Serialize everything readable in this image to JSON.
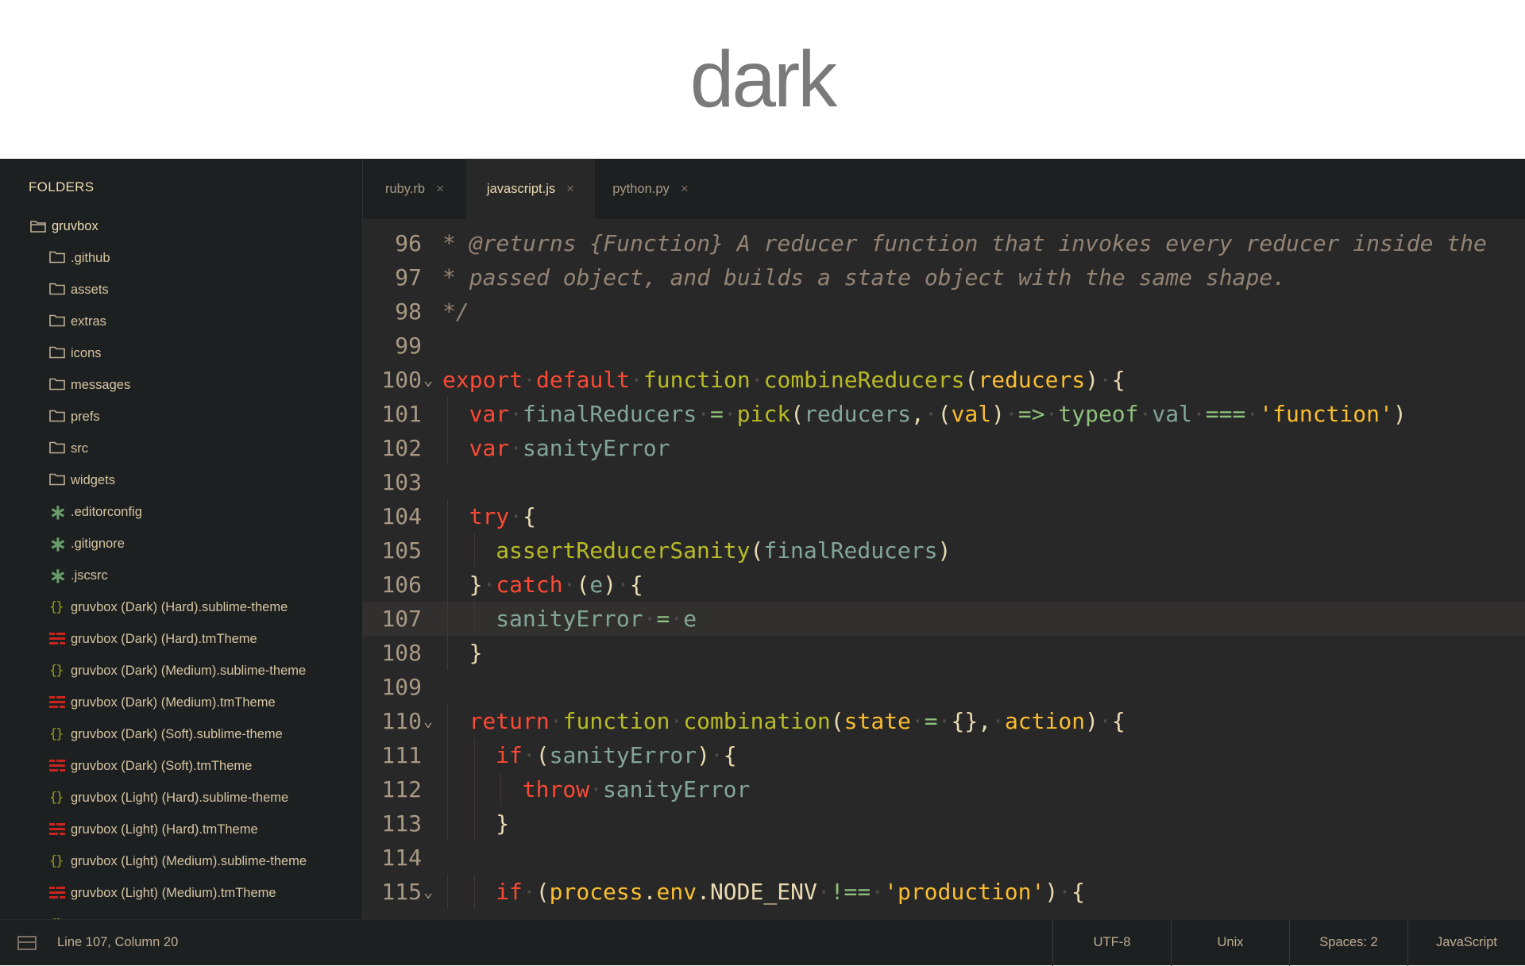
{
  "page": {
    "title": "dark"
  },
  "sidebar": {
    "header": "FOLDERS",
    "root": "gruvbox",
    "items": [
      {
        "label": ".github",
        "icon": "folder-icon"
      },
      {
        "label": "assets",
        "icon": "folder-icon"
      },
      {
        "label": "extras",
        "icon": "folder-icon"
      },
      {
        "label": "icons",
        "icon": "folder-icon"
      },
      {
        "label": "messages",
        "icon": "folder-icon"
      },
      {
        "label": "prefs",
        "icon": "folder-icon"
      },
      {
        "label": "src",
        "icon": "folder-icon"
      },
      {
        "label": "widgets",
        "icon": "folder-icon"
      },
      {
        "label": ".editorconfig",
        "icon": "asterisk-icon"
      },
      {
        "label": ".gitignore",
        "icon": "asterisk-icon"
      },
      {
        "label": ".jscsrc",
        "icon": "asterisk-icon"
      },
      {
        "label": "gruvbox (Dark) (Hard).sublime-theme",
        "icon": "braces-icon"
      },
      {
        "label": "gruvbox (Dark) (Hard).tmTheme",
        "icon": "lines-icon"
      },
      {
        "label": "gruvbox (Dark) (Medium).sublime-theme",
        "icon": "braces-icon"
      },
      {
        "label": "gruvbox (Dark) (Medium).tmTheme",
        "icon": "lines-icon"
      },
      {
        "label": "gruvbox (Dark) (Soft).sublime-theme",
        "icon": "braces-icon"
      },
      {
        "label": "gruvbox (Dark) (Soft).tmTheme",
        "icon": "lines-icon"
      },
      {
        "label": "gruvbox (Light) (Hard).sublime-theme",
        "icon": "braces-icon"
      },
      {
        "label": "gruvbox (Light) (Hard).tmTheme",
        "icon": "lines-icon"
      },
      {
        "label": "gruvbox (Light) (Medium).sublime-theme",
        "icon": "braces-icon"
      },
      {
        "label": "gruvbox (Light) (Medium).tmTheme",
        "icon": "lines-icon"
      },
      {
        "label": "gruvbox (Light) (Soft).sublime-theme",
        "icon": "braces-icon"
      }
    ]
  },
  "tabs": [
    {
      "label": "ruby.rb",
      "active": false
    },
    {
      "label": "javascript.js",
      "active": true
    },
    {
      "label": "python.py",
      "active": false
    }
  ],
  "tab_close_glyph": "×",
  "editor": {
    "current_line": 107,
    "lines": [
      {
        "n": "96",
        "fold": "",
        "indent": 0,
        "tokens": [
          [
            "c",
            "* @returns {Function} A reducer function that invokes every reducer inside the"
          ]
        ]
      },
      {
        "n": "97",
        "fold": "",
        "indent": 0,
        "tokens": [
          [
            "c",
            "* passed object, and builds a state object with the same shape."
          ]
        ]
      },
      {
        "n": "98",
        "fold": "",
        "indent": 0,
        "tokens": [
          [
            "c",
            "*/"
          ]
        ]
      },
      {
        "n": "99",
        "fold": "",
        "indent": 0,
        "tokens": []
      },
      {
        "n": "100",
        "fold": "⌄",
        "indent": 0,
        "tokens": [
          [
            "k",
            "export"
          ],
          [
            "d",
            "·"
          ],
          [
            "k",
            "default"
          ],
          [
            "d",
            "·"
          ],
          [
            "f",
            "function"
          ],
          [
            "d",
            "·"
          ],
          [
            "s",
            "combineReducers"
          ],
          [
            "p",
            "("
          ],
          [
            "y",
            "reducers"
          ],
          [
            "p",
            ")"
          ],
          [
            "d",
            "·"
          ],
          [
            "p",
            "{"
          ]
        ]
      },
      {
        "n": "101",
        "fold": "",
        "indent": 1,
        "tokens": [
          [
            "k",
            "var"
          ],
          [
            "d",
            "·"
          ],
          [
            "v",
            "finalReducers"
          ],
          [
            "d",
            "·"
          ],
          [
            "o",
            "="
          ],
          [
            "d",
            "·"
          ],
          [
            "s",
            "pick"
          ],
          [
            "p",
            "("
          ],
          [
            "v",
            "reducers"
          ],
          [
            "p",
            ","
          ],
          [
            "d",
            "·"
          ],
          [
            "p",
            "("
          ],
          [
            "y",
            "val"
          ],
          [
            "p",
            ")"
          ],
          [
            "d",
            "·"
          ],
          [
            "o",
            "=>"
          ],
          [
            "d",
            "·"
          ],
          [
            "v2",
            "typeof"
          ],
          [
            "d",
            "·"
          ],
          [
            "v",
            "val"
          ],
          [
            "d",
            "·"
          ],
          [
            "o",
            "==="
          ],
          [
            "d",
            "·"
          ],
          [
            "str",
            "'function'"
          ],
          [
            "p",
            ")"
          ]
        ]
      },
      {
        "n": "102",
        "fold": "",
        "indent": 1,
        "tokens": [
          [
            "k",
            "var"
          ],
          [
            "d",
            "·"
          ],
          [
            "v",
            "sanityError"
          ]
        ]
      },
      {
        "n": "103",
        "fold": "",
        "indent": 0,
        "tokens": []
      },
      {
        "n": "104",
        "fold": "",
        "indent": 1,
        "tokens": [
          [
            "k",
            "try"
          ],
          [
            "d",
            "·"
          ],
          [
            "p",
            "{"
          ]
        ]
      },
      {
        "n": "105",
        "fold": "",
        "indent": 2,
        "tokens": [
          [
            "s",
            "assertReducerSanity"
          ],
          [
            "p",
            "("
          ],
          [
            "v",
            "finalReducers"
          ],
          [
            "p",
            ")"
          ]
        ]
      },
      {
        "n": "106",
        "fold": "",
        "indent": 1,
        "tokens": [
          [
            "p",
            "}"
          ],
          [
            "d",
            "·"
          ],
          [
            "k",
            "catch"
          ],
          [
            "d",
            "·"
          ],
          [
            "p",
            "("
          ],
          [
            "v",
            "e"
          ],
          [
            "p",
            ")"
          ],
          [
            "d",
            "·"
          ],
          [
            "p",
            "{"
          ]
        ]
      },
      {
        "n": "107",
        "fold": "",
        "indent": 2,
        "tokens": [
          [
            "v",
            "sanityError"
          ],
          [
            "d",
            "·"
          ],
          [
            "o",
            "="
          ],
          [
            "d",
            "·"
          ],
          [
            "v",
            "e"
          ]
        ]
      },
      {
        "n": "108",
        "fold": "",
        "indent": 1,
        "tokens": [
          [
            "p",
            "}"
          ]
        ]
      },
      {
        "n": "109",
        "fold": "",
        "indent": 0,
        "tokens": []
      },
      {
        "n": "110",
        "fold": "⌄",
        "indent": 1,
        "tokens": [
          [
            "k",
            "return"
          ],
          [
            "d",
            "·"
          ],
          [
            "f",
            "function"
          ],
          [
            "d",
            "·"
          ],
          [
            "s",
            "combination"
          ],
          [
            "p",
            "("
          ],
          [
            "y",
            "state"
          ],
          [
            "d",
            "·"
          ],
          [
            "o",
            "="
          ],
          [
            "d",
            "·"
          ],
          [
            "p",
            "{},"
          ],
          [
            "d",
            "·"
          ],
          [
            "y",
            "action"
          ],
          [
            "p",
            ")"
          ],
          [
            "d",
            "·"
          ],
          [
            "p",
            "{"
          ]
        ]
      },
      {
        "n": "111",
        "fold": "",
        "indent": 2,
        "tokens": [
          [
            "k",
            "if"
          ],
          [
            "d",
            "·"
          ],
          [
            "p",
            "("
          ],
          [
            "v",
            "sanityError"
          ],
          [
            "p",
            ")"
          ],
          [
            "d",
            "·"
          ],
          [
            "p",
            "{"
          ]
        ]
      },
      {
        "n": "112",
        "fold": "",
        "indent": 3,
        "tokens": [
          [
            "k",
            "throw"
          ],
          [
            "d",
            "·"
          ],
          [
            "v",
            "sanityError"
          ]
        ]
      },
      {
        "n": "113",
        "fold": "",
        "indent": 2,
        "tokens": [
          [
            "p",
            "}"
          ]
        ]
      },
      {
        "n": "114",
        "fold": "",
        "indent": 0,
        "tokens": []
      },
      {
        "n": "115",
        "fold": "⌄",
        "indent": 2,
        "tokens": [
          [
            "k",
            "if"
          ],
          [
            "d",
            "·"
          ],
          [
            "p",
            "("
          ],
          [
            "str",
            "process"
          ],
          [
            "p",
            "."
          ],
          [
            "str",
            "env"
          ],
          [
            "p",
            "."
          ],
          [
            "p",
            "NODE_ENV"
          ],
          [
            "d",
            "·"
          ],
          [
            "o",
            "!=="
          ],
          [
            "d",
            "·"
          ],
          [
            "str",
            "'production'"
          ],
          [
            "p",
            ")"
          ],
          [
            "d",
            "·"
          ],
          [
            "p",
            "{"
          ]
        ]
      }
    ]
  },
  "status": {
    "position": "Line 107, Column 20",
    "encoding": "UTF-8",
    "line_endings": "Unix",
    "indentation": "Spaces: 2",
    "syntax": "JavaScript"
  },
  "colors": {
    "background": "#282828",
    "sidebar": "#1d2021",
    "keyword": "#fb4934",
    "function": "#b8bb26",
    "variable": "#83a598",
    "string": "#fabd2f",
    "comment": "#928374",
    "operator": "#8ec07c"
  }
}
